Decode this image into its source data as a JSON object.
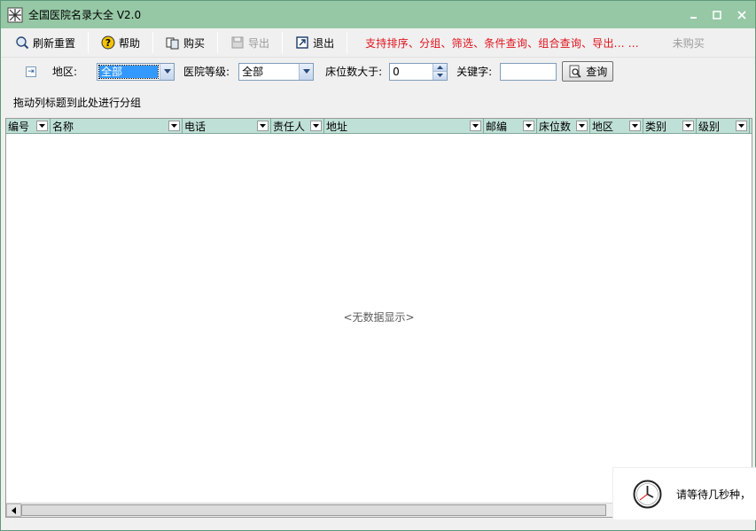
{
  "window": {
    "title": "全国医院名录大全 V2.0",
    "accent": "#96c8a6"
  },
  "toolbar": {
    "refresh_label": "刷新重置",
    "help_label": "帮助",
    "buy_label": "购买",
    "export_label": "导出",
    "exit_label": "退出",
    "promo_text": "支持排序、分组、筛选、条件查询、组合查询、导出...  ...",
    "unbought_label": "未购买"
  },
  "filter": {
    "region_label": "地区:",
    "region_value": "全部",
    "grade_label": "医院等级:",
    "grade_value": "全部",
    "beds_label": "床位数大于:",
    "beds_value": "0",
    "keyword_label": "关键字:",
    "keyword_value": "",
    "query_label": "查询"
  },
  "group_panel": {
    "hint": "拖动列标题到此处进行分组"
  },
  "grid": {
    "columns": [
      {
        "label": "编号"
      },
      {
        "label": "名称"
      },
      {
        "label": "电话"
      },
      {
        "label": "责任人"
      },
      {
        "label": "地址"
      },
      {
        "label": "邮编"
      },
      {
        "label": "床位数"
      },
      {
        "label": "地区"
      },
      {
        "label": "类别"
      },
      {
        "label": "级别"
      }
    ],
    "empty_text": "<无数据显示>"
  },
  "wait": {
    "message": "请等待几秒种，"
  }
}
